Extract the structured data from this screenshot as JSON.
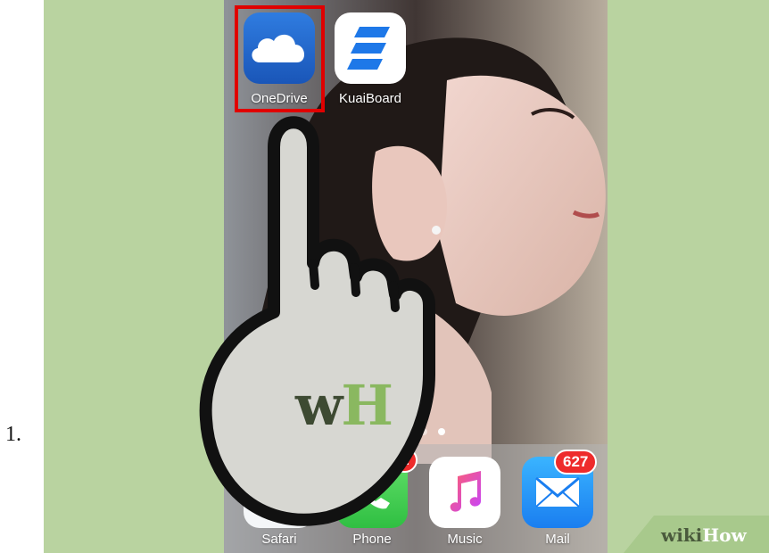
{
  "step": {
    "number": "1."
  },
  "home_screen": {
    "apps": [
      {
        "label": "OneDrive",
        "icon": "cloud-icon",
        "color": "#1e63c8",
        "highlighted": true
      },
      {
        "label": "KuaiBoard",
        "icon": "kuaiboard-icon",
        "color": "#ffffff"
      }
    ],
    "page_indicator": {
      "pages": 4,
      "current": 4
    }
  },
  "dock": {
    "apps": [
      {
        "label": "Safari",
        "icon": "compass-icon"
      },
      {
        "label": "Phone",
        "icon": "phone-icon",
        "badge": "1"
      },
      {
        "label": "Music",
        "icon": "music-note-icon"
      },
      {
        "label": "Mail",
        "icon": "envelope-icon",
        "badge": "627"
      }
    ]
  },
  "overlay": {
    "pointer": "hand-pointer-icon",
    "logo_w": "w",
    "logo_h": "H",
    "logo_w_color": "#3d4a32",
    "logo_h_color": "#8ab860"
  },
  "watermark": {
    "part1": "wiki",
    "part2": "How"
  },
  "colors": {
    "background": "#b9d3a0",
    "highlight": "#e00000",
    "badge": "#ee2b2b"
  }
}
